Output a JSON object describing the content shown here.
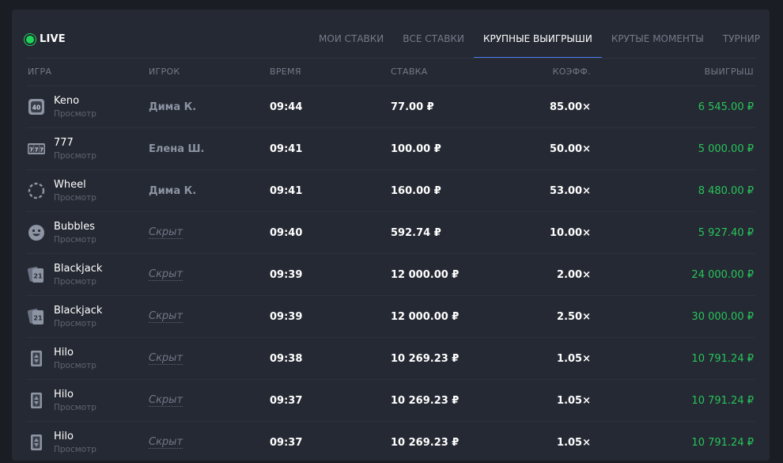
{
  "live": {
    "label": "LIVE",
    "color": "#1ed45a"
  },
  "tabs": [
    {
      "label": "МОИ СТАВКИ"
    },
    {
      "label": "ВСЕ СТАВКИ"
    },
    {
      "label": "КРУПНЫЕ ВЫИГРЫШИ",
      "active": true
    },
    {
      "label": "КРУТЫЕ МОМЕНТЫ"
    },
    {
      "label": "ТУРНИР"
    }
  ],
  "columns": {
    "game": "ИГРА",
    "player": "ИГРОК",
    "time": "ВРЕМЯ",
    "bet": "СТАВКА",
    "coef": "КОЭФФ.",
    "win": "ВЫИГРЫШ"
  },
  "rows": [
    {
      "game": "Keno",
      "sub": "Просмотр",
      "icon": "keno-icon",
      "player": "Дима К.",
      "hidden": false,
      "time": "09:44",
      "bet": "77.00 ₽",
      "coef": "85.00×",
      "win": "6 545.00 ₽"
    },
    {
      "game": "777",
      "sub": "Просмотр",
      "icon": "slots-777-icon",
      "player": "Елена Ш.",
      "hidden": false,
      "time": "09:41",
      "bet": "100.00 ₽",
      "coef": "50.00×",
      "win": "5 000.00 ₽"
    },
    {
      "game": "Wheel",
      "sub": "Просмотр",
      "icon": "wheel-icon",
      "player": "Дима К.",
      "hidden": false,
      "time": "09:41",
      "bet": "160.00 ₽",
      "coef": "53.00×",
      "win": "8 480.00 ₽"
    },
    {
      "game": "Bubbles",
      "sub": "Просмотр",
      "icon": "smiley-icon",
      "player": "Скрыт",
      "hidden": true,
      "time": "09:40",
      "bet": "592.74 ₽",
      "coef": "10.00×",
      "win": "5 927.40 ₽"
    },
    {
      "game": "Blackjack",
      "sub": "Просмотр",
      "icon": "blackjack-cards-icon",
      "player": "Скрыт",
      "hidden": true,
      "time": "09:39",
      "bet": "12 000.00 ₽",
      "coef": "2.00×",
      "win": "24 000.00 ₽"
    },
    {
      "game": "Blackjack",
      "sub": "Просмотр",
      "icon": "blackjack-cards-icon",
      "player": "Скрыт",
      "hidden": true,
      "time": "09:39",
      "bet": "12 000.00 ₽",
      "coef": "2.50×",
      "win": "30 000.00 ₽"
    },
    {
      "game": "Hilo",
      "sub": "Просмотр",
      "icon": "hilo-card-icon",
      "player": "Скрыт",
      "hidden": true,
      "time": "09:38",
      "bet": "10 269.23 ₽",
      "coef": "1.05×",
      "win": "10 791.24 ₽"
    },
    {
      "game": "Hilo",
      "sub": "Просмотр",
      "icon": "hilo-card-icon",
      "player": "Скрыт",
      "hidden": true,
      "time": "09:37",
      "bet": "10 269.23 ₽",
      "coef": "1.05×",
      "win": "10 791.24 ₽"
    },
    {
      "game": "Hilo",
      "sub": "Просмотр",
      "icon": "hilo-card-icon",
      "player": "Скрыт",
      "hidden": true,
      "time": "09:37",
      "bet": "10 269.23 ₽",
      "coef": "1.05×",
      "win": "10 791.24 ₽"
    }
  ],
  "colors": {
    "win": "#27c45a",
    "accent": "#4a78f0",
    "panel": "#252933"
  }
}
